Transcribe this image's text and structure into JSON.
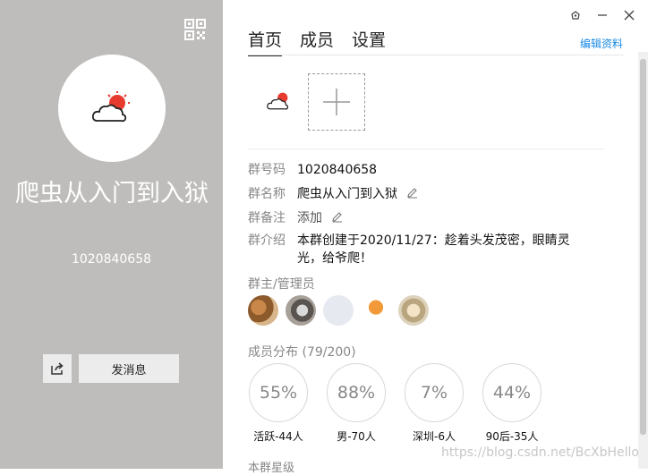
{
  "left_panel": {
    "group_name": "爬虫从入门到入狱",
    "group_id": "1020840658",
    "send_button": "发消息"
  },
  "tabs": [
    {
      "label": "首页",
      "active": true
    },
    {
      "label": "成员",
      "active": false
    },
    {
      "label": "设置",
      "active": false
    }
  ],
  "edit_link": "编辑资料",
  "info": {
    "group_no_label": "群号码",
    "group_no_value": "1020840658",
    "group_name_label": "群名称",
    "group_name_value": "爬虫从入门到入狱",
    "remark_label": "群备注",
    "remark_value": "添加",
    "intro_label": "群介绍",
    "intro_line1": "本群创建于2020/11/27：趁着头发茂密，眼睛灵",
    "intro_line2": "光，给爷爬！"
  },
  "admins_title": "群主/管理员",
  "distribution": {
    "title": "成员分布 (79/200)",
    "items": [
      {
        "value": "55%",
        "label": "活跃-44人"
      },
      {
        "value": "88%",
        "label": "男-70人"
      },
      {
        "value": "7%",
        "label": "深圳-6人"
      },
      {
        "value": "44%",
        "label": "90后-35人"
      }
    ]
  },
  "bottom_section_title": "本群星级",
  "watermark": "https://blog.csdn.net/BcXbHello",
  "colors": {
    "left_bg": "#bebdbb",
    "accent": "#1a8ae6"
  }
}
